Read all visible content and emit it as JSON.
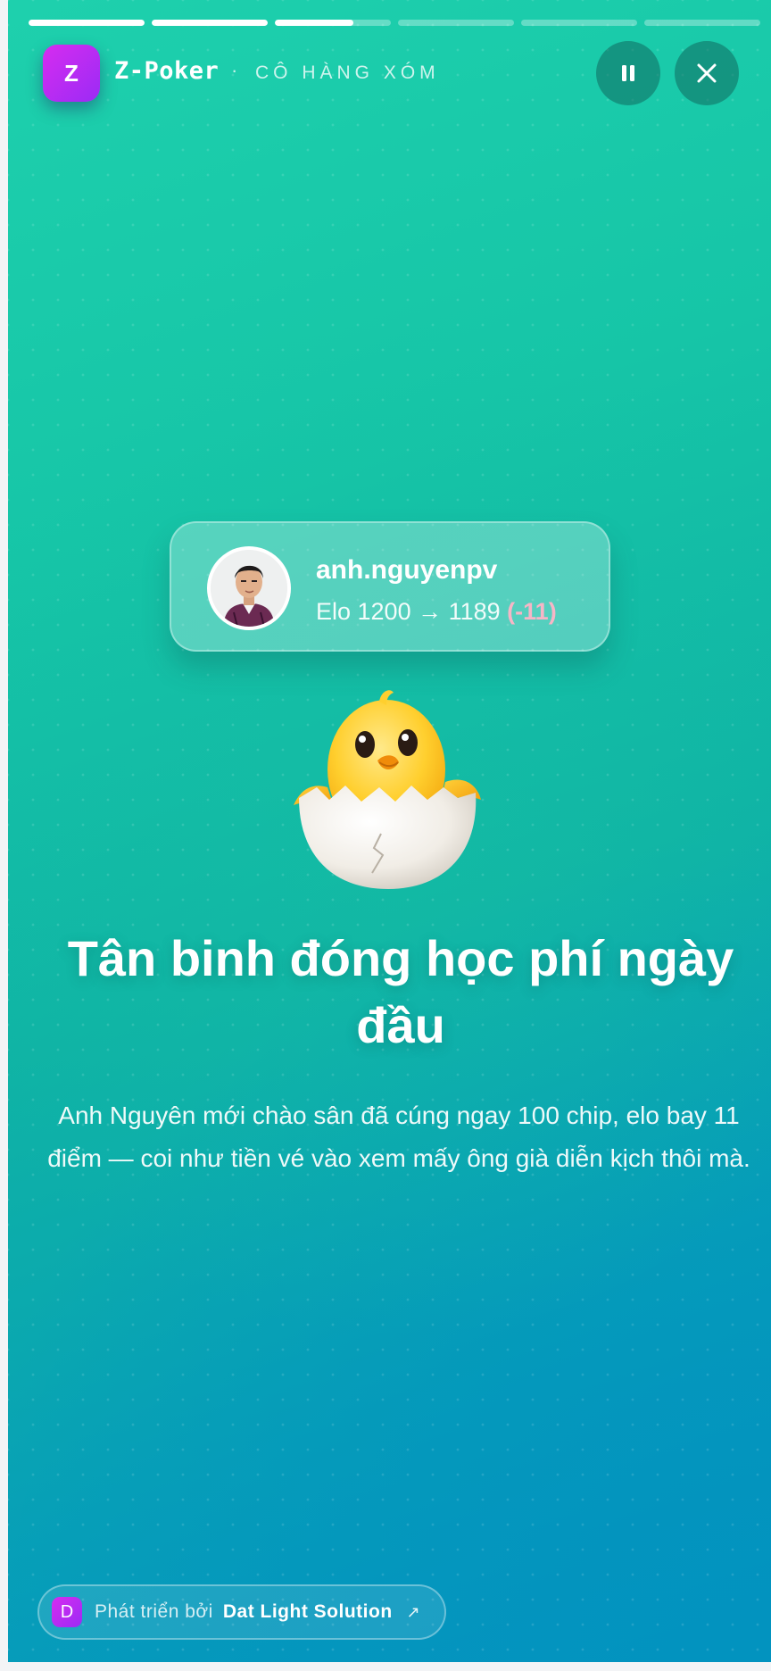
{
  "progress": {
    "segments": [
      1,
      1,
      0.68,
      0,
      0,
      0
    ]
  },
  "header": {
    "brand_letter": "Z",
    "brand_name": "Z-Poker",
    "separator": "·",
    "subtitle": "CÔ HÀNG XÓM",
    "pause_icon": "pause-icon",
    "close_icon": "close-icon"
  },
  "profile": {
    "username": "anh.nguyenpv",
    "elo_text": "Elo 1200 → 1189",
    "elo_delta": "(-11)"
  },
  "story": {
    "emoji": "hatching-chick-icon",
    "title": "Tân binh đóng học phí ngày đầu",
    "description": "Anh Nguyên mới chào sân đã cúng ngay 100 chip, elo bay 11 điểm — coi như tiền vé vào xem mấy ông già diễn kịch thôi mà."
  },
  "credit": {
    "badge_letter": "D",
    "prefix": "Phát triển bởi",
    "name": "Dat Light Solution",
    "arrow": "↗"
  },
  "colors": {
    "accent_purple": "#b02cf3",
    "background_top": "#1ed0ad",
    "background_bottom": "#0593c1",
    "elo_delta": "#f6b6c6"
  }
}
